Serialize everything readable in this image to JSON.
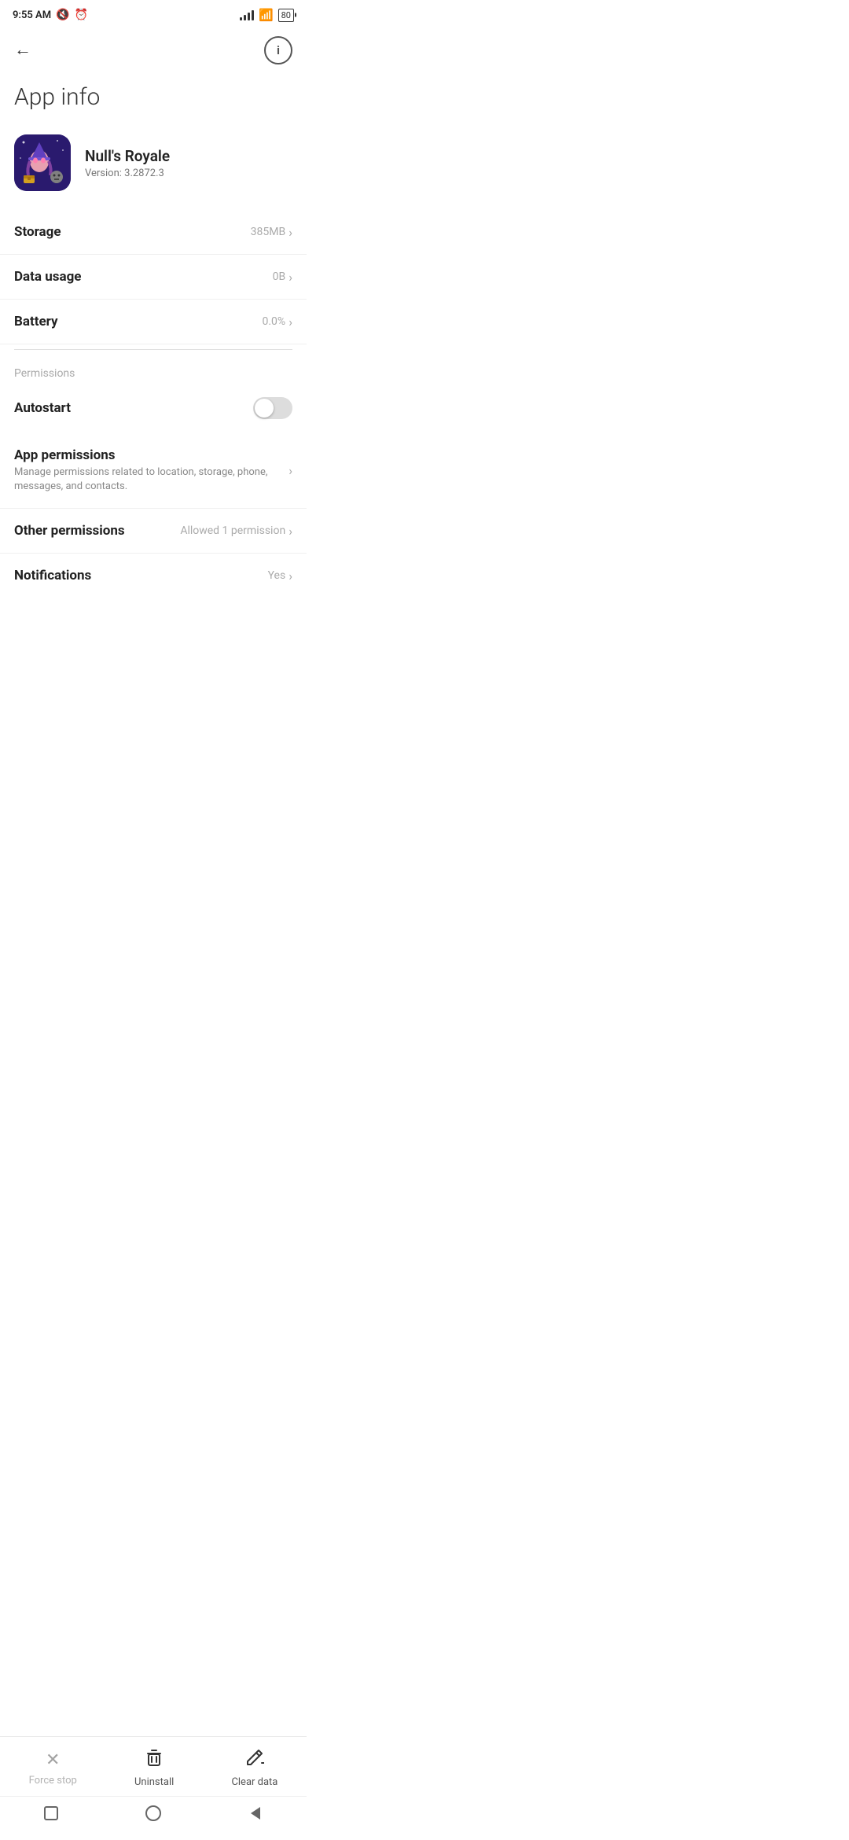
{
  "statusBar": {
    "time": "9:55 AM",
    "battery": "80"
  },
  "header": {
    "title": "App info"
  },
  "app": {
    "name": "Null's Royale",
    "version": "Version: 3.2872.3"
  },
  "sections": {
    "storage": {
      "label": "Storage",
      "value": "385MB"
    },
    "dataUsage": {
      "label": "Data usage",
      "value": "0B"
    },
    "battery": {
      "label": "Battery",
      "value": "0.0%"
    },
    "permissionsLabel": "Permissions",
    "autostart": {
      "label": "Autostart"
    },
    "appPermissions": {
      "label": "App permissions",
      "subtitle": "Manage permissions related to location, storage, phone, messages, and contacts."
    },
    "otherPermissions": {
      "label": "Other permissions",
      "value": "Allowed 1 permission"
    },
    "notifications": {
      "label": "Notifications",
      "value": "Yes"
    }
  },
  "bottomActions": {
    "forceStop": "Force stop",
    "uninstall": "Uninstall",
    "clearData": "Clear data"
  },
  "navBar": {
    "square": "■",
    "circle": "●",
    "triangle": "◀"
  }
}
